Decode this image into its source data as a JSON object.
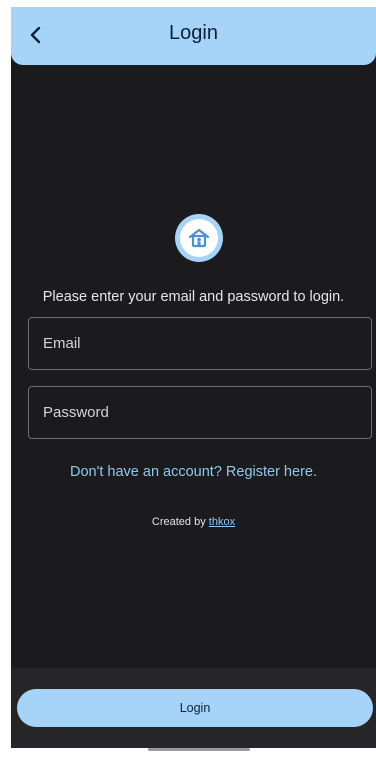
{
  "app_bar": {
    "title": "Login",
    "back_icon": "chevron-left-icon"
  },
  "logo": {
    "icon": "home-icon"
  },
  "form": {
    "instructions": "Please enter your email and password to login.",
    "email_placeholder": "Email",
    "password_placeholder": "Password",
    "register_link": "Don't have an account? Register here."
  },
  "credits": {
    "prefix": "Created by",
    "author": "thkox"
  },
  "footer": {
    "login_button": "Login"
  },
  "colors": {
    "accent": "#a6d4f8",
    "background": "#1b1b1d",
    "link": "#8ec8f0"
  }
}
